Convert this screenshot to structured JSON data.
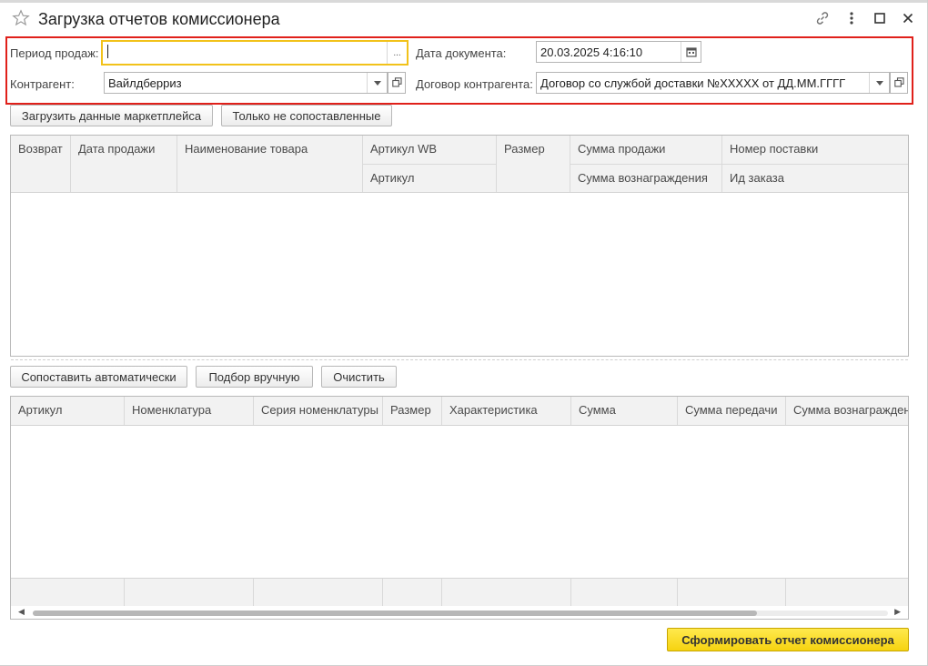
{
  "window": {
    "title": "Загрузка отчетов комиссионера",
    "icons": [
      "star-icon",
      "link-icon",
      "more-icon",
      "maximize-icon",
      "close-icon"
    ]
  },
  "form": {
    "period_label": "Период продаж:",
    "period_value": "",
    "period_button": "...",
    "doc_date_label": "Дата документа:",
    "doc_date_value": "20.03.2025  4:16:10",
    "counterparty_label": "Контрагент:",
    "counterparty_value": "Вайлдберриз",
    "contract_label": "Договор контрагента:",
    "contract_value": "Договор со службой доставки №XXXXX от ДД.ММ.ГГГГ"
  },
  "toolbar_top": {
    "load_button": "Загрузить данные маркетплейса",
    "unmatched_button": "Только не сопоставленные"
  },
  "table_top": {
    "headers_row1": [
      "Возврат",
      "Дата продажи",
      "Наименование товара",
      "Артикул WB",
      "Размер",
      "Сумма продажи",
      "Номер поставки"
    ],
    "headers_row2": [
      "Артикул",
      "Сумма вознаграждения",
      "Ид заказа"
    ],
    "rows": []
  },
  "toolbar_bottom": {
    "auto_button": "Сопоставить автоматически",
    "manual_button": "Подбор вручную",
    "clear_button": "Очистить"
  },
  "table_bottom": {
    "headers": [
      "Артикул",
      "Номенклатура",
      "Серия номенклатуры",
      "Размер",
      "Характеристика",
      "Сумма",
      "Сумма передачи",
      "Сумма вознагражден"
    ],
    "rows": [],
    "scroll_position": 0.0
  },
  "footer": {
    "submit_button": "Сформировать отчет комиссионера"
  },
  "colors": {
    "highlight": "#e0201a",
    "focus": "#f2c21a",
    "primary_button": "#f6d310"
  }
}
